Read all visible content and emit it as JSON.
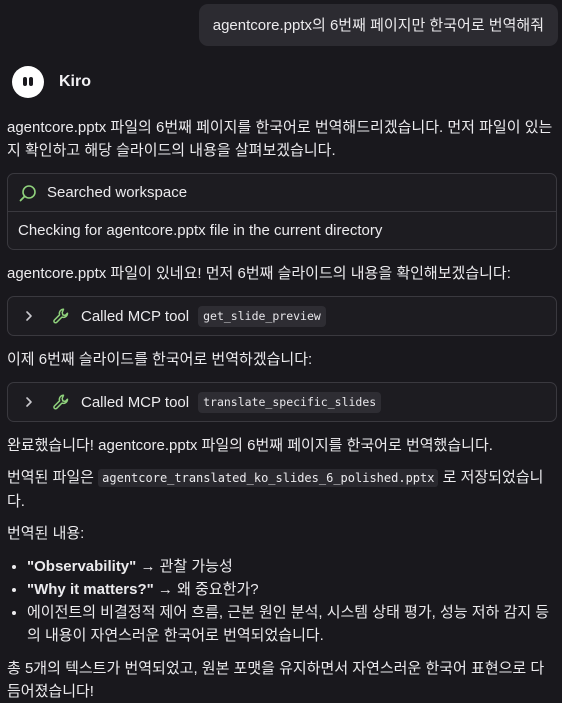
{
  "user_message": "agentcore.pptx의 6번째 페이지만 한국어로 번역해줘",
  "agent": {
    "name": "Kiro"
  },
  "messages": {
    "intro": "agentcore.pptx 파일의 6번째 페이지를 한국어로 번역해드리겠습니다. 먼저 파일이 있는지 확인하고 해당 슬라이드의 내용을 살펴보겠습니다.",
    "found_file": "agentcore.pptx 파일이 있네요! 먼저 6번째 슬라이드의 내용을 확인해보겠습니다:",
    "translate_now": "이제 6번째 슬라이드를 한국어로 번역하겠습니다:",
    "done": "완료했습니다! agentcore.pptx 파일의 6번째 페이지를 한국어로 번역했습니다.",
    "saved_prefix": "번역된 파일은",
    "saved_filename": "agentcore_translated_ko_slides_6_polished.pptx",
    "saved_suffix": "로 저장되었습니다.",
    "translated_heading": "번역된 내용:",
    "summary": "총 5개의 텍스트가 번역되었고, 원본 포맷을 유지하면서 자연스러운 한국어 표현으로 다듬어졌습니다!"
  },
  "search_card": {
    "title": "Searched workspace",
    "detail": "Checking for agentcore.pptx file in the current directory",
    "icon": "search-icon"
  },
  "tool_calls": [
    {
      "label": "Called MCP tool",
      "tool": "get_slide_preview",
      "icon": "wrench-icon"
    },
    {
      "label": "Called MCP tool",
      "tool": "translate_specific_slides",
      "icon": "wrench-icon"
    }
  ],
  "translations": [
    {
      "source": "\"Observability\"",
      "arrow": "→",
      "target": "관찰 가능성"
    },
    {
      "source": "\"Why it matters?\"",
      "arrow": "→",
      "target": "왜 중요한가?"
    },
    {
      "text": "에이전트의 비결정적 제어 흐름, 근본 원인 분석, 시스템 상태 평가, 성능 저하 감지 등의 내용이 자연스러운 한국어로 번역되었습니다."
    }
  ],
  "colors": {
    "background": "#19181d",
    "card_border": "#3a393f",
    "icon_green": "#8fd17c",
    "text": "#ecebee"
  }
}
